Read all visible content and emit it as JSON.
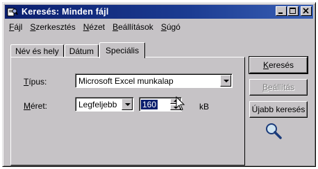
{
  "window": {
    "title": "Keresés: Minden fájl"
  },
  "menubar": {
    "items": [
      {
        "pre": "",
        "key": "F",
        "post": "ájl"
      },
      {
        "pre": "",
        "key": "S",
        "post": "zerkesztés"
      },
      {
        "pre": "",
        "key": "N",
        "post": "ézet"
      },
      {
        "pre": "",
        "key": "B",
        "post": "eállítások"
      },
      {
        "pre": "",
        "key": "S",
        "post": "úgó"
      }
    ]
  },
  "tabs": [
    {
      "label": "Név és hely"
    },
    {
      "label": "Dátum"
    },
    {
      "label": "Speciális"
    }
  ],
  "form": {
    "type_label_key": "T",
    "type_label_rest": "ípus:",
    "type_value": "Microsoft Excel munkalap",
    "size_label_key": "M",
    "size_label_rest": "éret:",
    "size_mode": "Legfeljebb",
    "size_value": "160",
    "size_unit": "kB"
  },
  "buttons": {
    "search_key": "K",
    "search_rest": "eresés",
    "settings_key": "B",
    "settings_rest": "eállítás",
    "new_search_pre": "Ú",
    "new_search_key": "j",
    "new_search_rest": "abb keresés"
  },
  "colors": {
    "titlebar": "#0b1f6e",
    "face": "#c6c3c6",
    "selection": "#0b1f6e"
  },
  "icons": [
    "find-app-icon",
    "minimize-icon",
    "maximize-icon",
    "close-icon",
    "chevron-down-icon",
    "magnifier-icon",
    "mouse-cursor-icon"
  ]
}
